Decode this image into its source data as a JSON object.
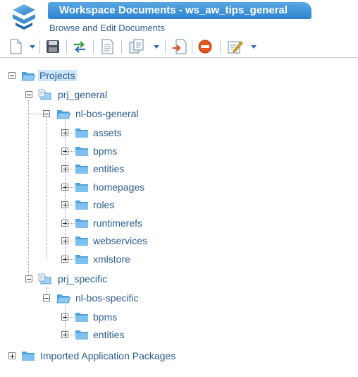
{
  "header": {
    "title": "Workspace Documents - ws_aw_tips_general",
    "subtitle": "Browse and Edit Documents"
  },
  "toolbar": {
    "items": [
      "new-document-icon",
      "save-icon",
      "synchronize-icon",
      "document-icon",
      "copy-icon",
      "import-icon",
      "stop-icon",
      "edit-icon"
    ]
  },
  "colors": {
    "title_bar": "#3f93d8",
    "folder": "#5ab0ec",
    "selection": "#cde6fb",
    "label": "#2b5b8e"
  },
  "tree": {
    "root": "Projects",
    "project1": "prj_general",
    "package1": "nl-bos-general",
    "package1_children": [
      "assets",
      "bpms",
      "entities",
      "homepages",
      "roles",
      "runtimerefs",
      "webservices",
      "xmlstore"
    ],
    "project2": "prj_specific",
    "package2": "nl-bos-specific",
    "package2_children": [
      "bpms",
      "entities"
    ],
    "imported": "Imported Application Packages"
  }
}
